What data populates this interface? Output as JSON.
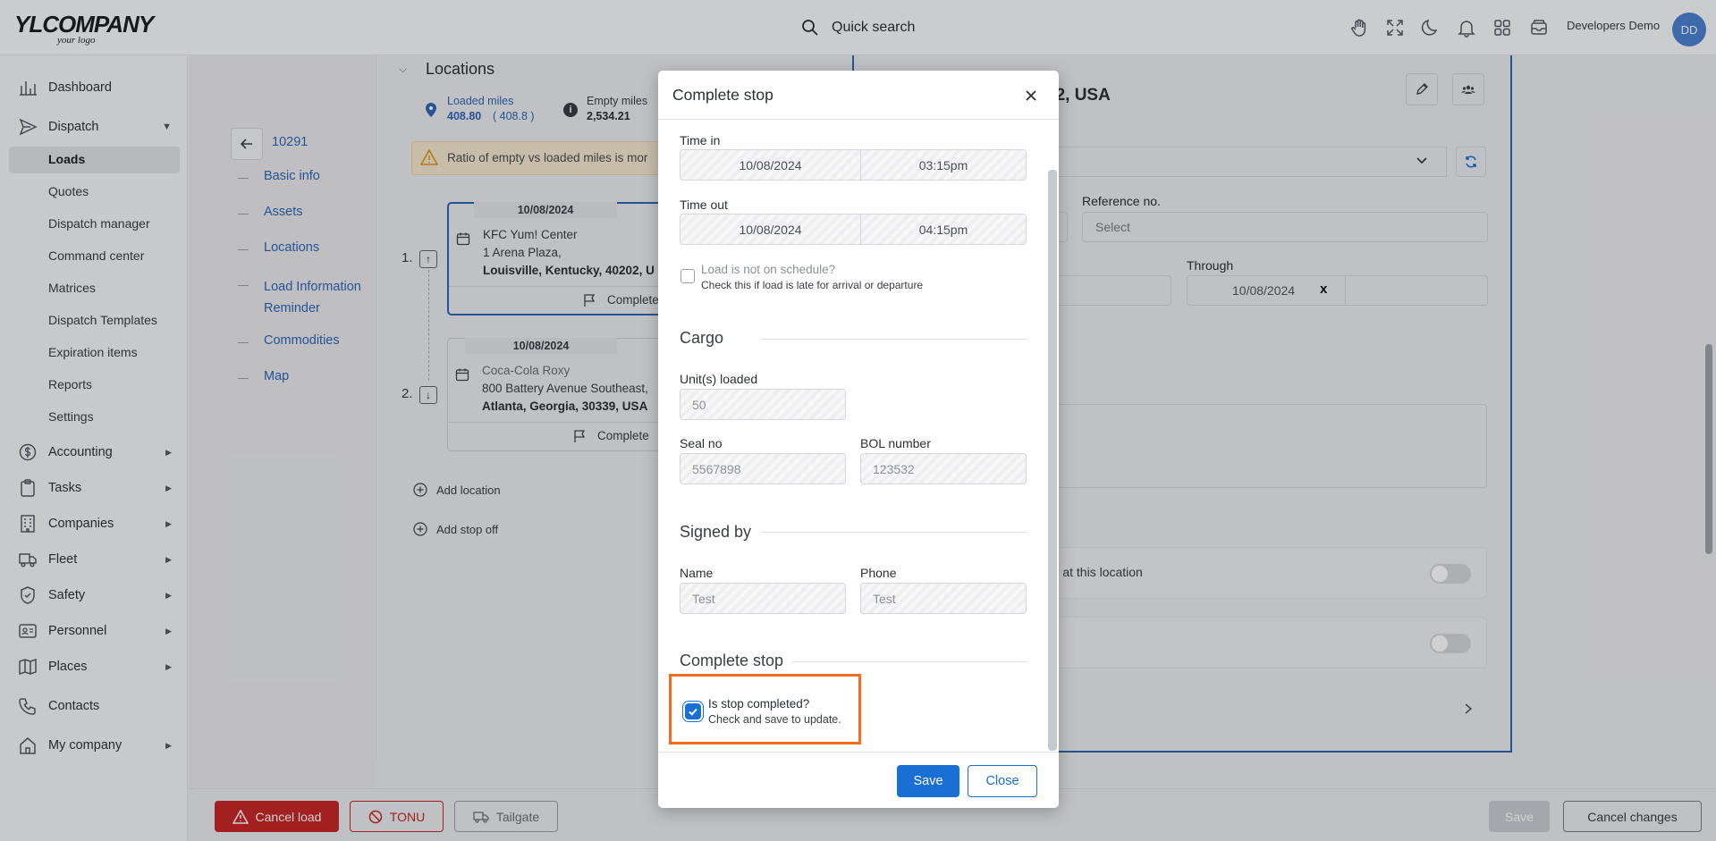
{
  "header": {
    "logo_main": "YLCOMPANY",
    "logo_sub": "your logo",
    "search_label": "Quick search",
    "user_name": "Developers Demo",
    "avatar_initials": "DD"
  },
  "sidebar": {
    "dashboard": "Dashboard",
    "dispatch": "Dispatch",
    "dispatch_sub": [
      "Loads",
      "Quotes",
      "Dispatch manager",
      "Command center",
      "Matrices",
      "Dispatch Templates",
      "Expiration items",
      "Reports",
      "Settings"
    ],
    "accounting": "Accounting",
    "tasks": "Tasks",
    "companies": "Companies",
    "fleet": "Fleet",
    "safety": "Safety",
    "personnel": "Personnel",
    "places": "Places",
    "contacts": "Contacts",
    "my_company": "My company"
  },
  "load_nav": {
    "load_id": "10291",
    "items": [
      "Basic info",
      "Assets",
      "Locations",
      "Load Information Reminder",
      "Commodities",
      "Map"
    ]
  },
  "locations": {
    "title": "Locations",
    "loaded_miles_label": "Loaded miles",
    "loaded_miles_value": "408.80",
    "loaded_miles_paren": "( 408.8 )",
    "empty_miles_label": "Empty miles",
    "empty_miles_value": "2,534.21",
    "warning": "Ratio of empty vs loaded miles is mor",
    "stops": [
      {
        "num": "1.",
        "date": "10/08/2024",
        "name": "KFC Yum! Center",
        "addr1": "1 Arena Plaza,",
        "addr2": "Louisville, Kentucky, 40202, U",
        "action": "Complete"
      },
      {
        "num": "2.",
        "date": "10/08/2024",
        "name": "Coca-Cola Roxy",
        "addr1": "800 Battery Avenue Southeast,",
        "addr2": "Atlanta, Georgia, 30339, USA",
        "action": "Complete"
      }
    ],
    "add_location": "Add location",
    "add_stop_off": "Add stop off"
  },
  "right_panel": {
    "address_fragment": "02, USA",
    "reference_label": "Reference no.",
    "reference_placeholder": "Select",
    "through_label": "Through",
    "through_value": "10/08/2024",
    "through_clear": "x",
    "toggle1_label": "er at this location"
  },
  "bottom_bar": {
    "cancel_load": "Cancel load",
    "tonu": "TONU",
    "tailgate": "Tailgate",
    "save": "Save",
    "cancel_changes": "Cancel changes"
  },
  "modal": {
    "title": "Complete stop",
    "time_in_label": "Time in",
    "time_in_date": "10/08/2024",
    "time_in_time": "03:15pm",
    "time_out_label": "Time out",
    "time_out_date": "10/08/2024",
    "time_out_time": "04:15pm",
    "schedule_label": "Load is not on schedule?",
    "schedule_hint": "Check this if load is late for arrival or departure",
    "cargo_section": "Cargo",
    "units_label": "Unit(s) loaded",
    "units_value": "50",
    "seal_label": "Seal no",
    "seal_value": "5567898",
    "bol_label": "BOL number",
    "bol_value": "123532",
    "signed_section": "Signed by",
    "name_label": "Name",
    "name_value": "Test",
    "phone_label": "Phone",
    "phone_value": "Test",
    "complete_section": "Complete stop",
    "completed_label": "Is stop completed?",
    "completed_hint": "Check and save to update.",
    "completed_checked": true,
    "save_label": "Save",
    "close_label": "Close"
  },
  "colors": {
    "primary": "#1a6fd4",
    "link": "#2e67b6",
    "danger": "#c62828",
    "highlight": "#f36c21"
  }
}
